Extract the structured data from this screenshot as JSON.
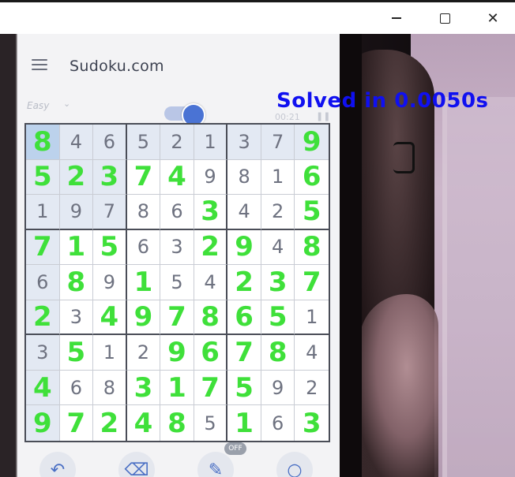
{
  "window": {
    "controls": {
      "minimize": "minimize",
      "maximize": "maximize",
      "close": "✕"
    }
  },
  "app": {
    "title": "Sudoku.com",
    "difficulty": "Easy",
    "timer": "00:21"
  },
  "overlay": {
    "solved_text": "Solved in 0.0050s"
  },
  "colors": {
    "solved_digit": "#3fe03a",
    "given_digit": "#6e7280",
    "overlay_text": "#1010f0",
    "toggle_accent": "#4a73d4"
  },
  "toolbar": {
    "off_badge": "OFF",
    "icons": [
      "undo-icon",
      "eraser-icon",
      "pencil-icon",
      "hint-icon"
    ]
  },
  "grid": {
    "rows": [
      [
        "8",
        "4",
        "6",
        "5",
        "2",
        "1",
        "3",
        "7",
        "9"
      ],
      [
        "5",
        "2",
        "3",
        "7",
        "4",
        "9",
        "8",
        "1",
        "6"
      ],
      [
        "1",
        "9",
        "7",
        "8",
        "6",
        "3",
        "4",
        "2",
        "5"
      ],
      [
        "7",
        "1",
        "5",
        "6",
        "3",
        "2",
        "9",
        "4",
        "8"
      ],
      [
        "6",
        "8",
        "9",
        "1",
        "5",
        "4",
        "2",
        "3",
        "7"
      ],
      [
        "2",
        "3",
        "4",
        "9",
        "7",
        "8",
        "6",
        "5",
        "1"
      ],
      [
        "3",
        "5",
        "1",
        "2",
        "9",
        "6",
        "7",
        "8",
        "4"
      ],
      [
        "4",
        "6",
        "8",
        "3",
        "1",
        "7",
        "5",
        "9",
        "2"
      ],
      [
        "9",
        "7",
        "2",
        "4",
        "8",
        "5",
        "1",
        "6",
        "3"
      ]
    ],
    "solved_mask": [
      [
        1,
        0,
        0,
        0,
        0,
        0,
        0,
        0,
        1
      ],
      [
        1,
        1,
        1,
        1,
        1,
        0,
        0,
        0,
        1
      ],
      [
        0,
        0,
        0,
        0,
        0,
        1,
        0,
        0,
        1
      ],
      [
        1,
        1,
        1,
        0,
        0,
        1,
        1,
        0,
        1
      ],
      [
        0,
        1,
        0,
        1,
        0,
        0,
        1,
        1,
        1
      ],
      [
        1,
        0,
        1,
        1,
        1,
        1,
        1,
        1,
        0
      ],
      [
        0,
        1,
        0,
        0,
        1,
        1,
        1,
        1,
        0
      ],
      [
        1,
        0,
        0,
        1,
        1,
        1,
        1,
        0,
        0
      ],
      [
        1,
        1,
        1,
        1,
        1,
        0,
        1,
        0,
        1
      ]
    ],
    "selected_cell": [
      0,
      0
    ]
  }
}
